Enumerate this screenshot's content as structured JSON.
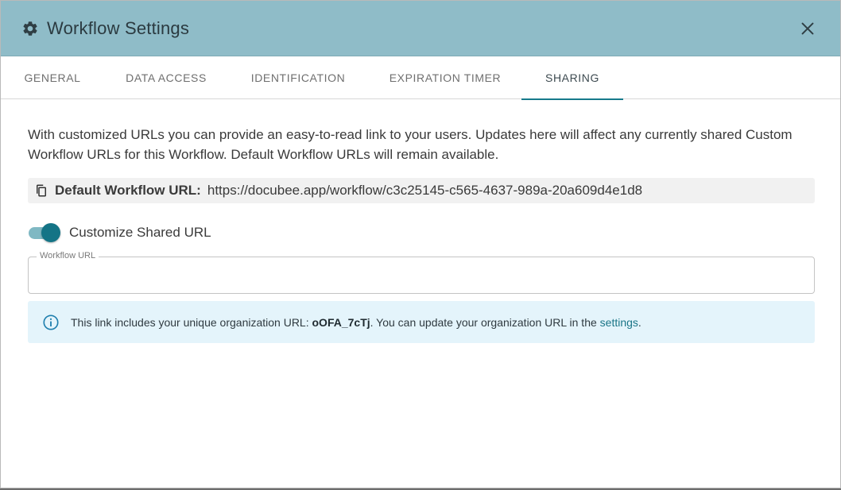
{
  "dialog": {
    "title": "Workflow Settings",
    "close_icon": "close-icon",
    "title_icon": "gear-icon"
  },
  "tabs": [
    {
      "label": "GENERAL",
      "active": false
    },
    {
      "label": "DATA ACCESS",
      "active": false
    },
    {
      "label": "IDENTIFICATION",
      "active": false
    },
    {
      "label": "EXPIRATION TIMER",
      "active": false
    },
    {
      "label": "SHARING",
      "active": true
    }
  ],
  "sharing": {
    "description": "With customized URLs you can provide an easy-to-read link to your users. Updates here will affect any currently shared Custom Workflow URLs for this Workflow. Default Workflow URLs will remain available.",
    "default_url_label": "Default Workflow URL:",
    "default_url_value": "https://docubee.app/workflow/c3c25145-c565-4637-989a-20a609d4e1d8",
    "toggle_label": "Customize Shared URL",
    "toggle_on": true,
    "workflow_url_label": "Workflow URL",
    "workflow_url_value": "",
    "info_prefix": "This link includes your unique organization URL: ",
    "info_org": "oOFA_7cTj",
    "info_middle": ". You can update your organization URL in the ",
    "info_link": "settings",
    "info_suffix": "."
  },
  "colors": {
    "header_bg": "#8fbcc8",
    "accent": "#167a8b",
    "info_bg": "#e4f4fb",
    "toggle_knob": "#147486"
  }
}
